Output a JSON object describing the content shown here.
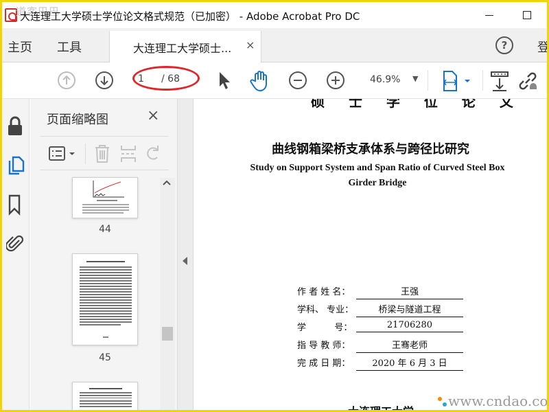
{
  "window": {
    "title": "大连理工大学硕士学位论文格式规范（已加密） - Adobe Acrobat Pro DC",
    "watermark": "道客巴巴"
  },
  "tabs": {
    "home": "主页",
    "tools": "工具",
    "document": "大连理工大学硕士...",
    "document_close": "×",
    "help": "?",
    "signin_cut": "登"
  },
  "toolbar": {
    "page_current": "1",
    "page_total": "/ 68",
    "zoom": "46.9%",
    "zoom_caret": "▼",
    "annotation_color": "#e0262a",
    "accent": "#1a73c7"
  },
  "rail": {
    "icons": [
      "lock-icon",
      "pages-icon",
      "bookmark-icon",
      "attachment-icon"
    ]
  },
  "thumbnails": {
    "title": "页面缩略图",
    "close": "×",
    "pages": [
      {
        "label": "44"
      },
      {
        "label": "45"
      },
      {
        "label": ""
      }
    ]
  },
  "document": {
    "cut_heading": "硕 士 学 位 论 文",
    "title_cn": "曲线钢箱梁桥支承体系与跨径比研究",
    "title_en": "Study on Support System and Span Ratio of Curved Steel Box Girder Bridge",
    "info": [
      {
        "label": "作 者 姓 名：",
        "value": "王强"
      },
      {
        "label": "学科、 专业：",
        "value": "桥梁与隧道工程"
      },
      {
        "label": "学          号：",
        "value": "21706280"
      },
      {
        "label": "指 导 教 师：",
        "value": "王骞老师"
      },
      {
        "label": "完 成 日 期：",
        "value": "2020 年 6 月 3 日"
      }
    ],
    "bottom_cut": "大连理工大学",
    "site_watermark": "www.cndao.com"
  }
}
